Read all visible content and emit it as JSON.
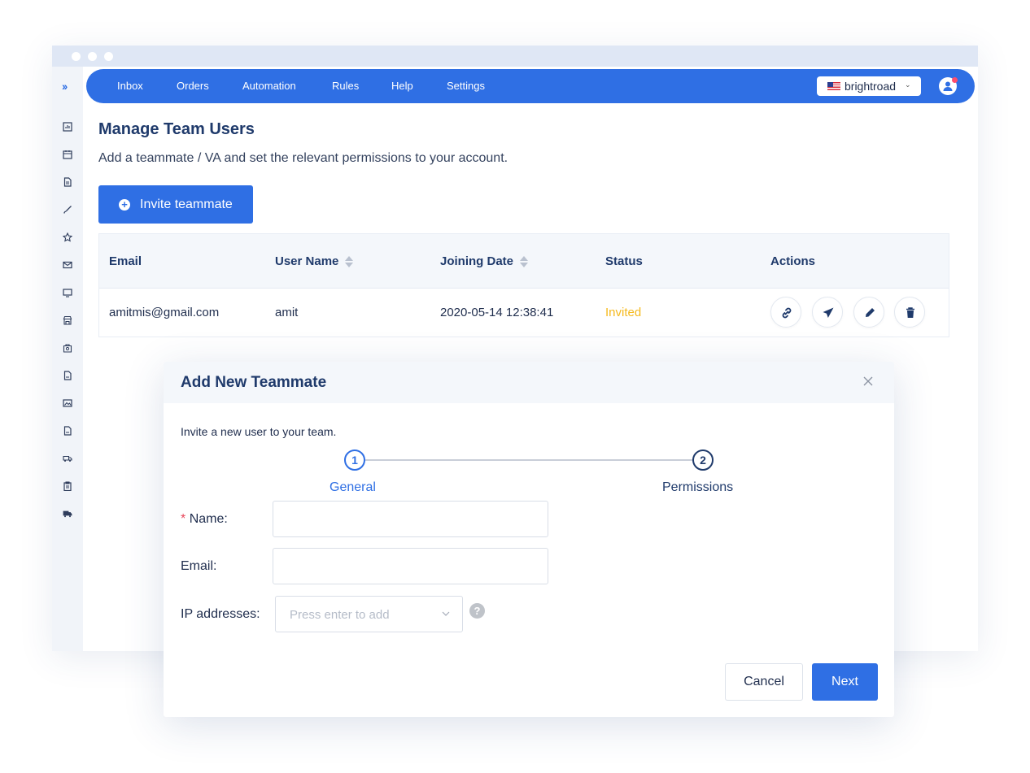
{
  "nav": {
    "items": [
      "Inbox",
      "Orders",
      "Automation",
      "Rules",
      "Help",
      "Settings"
    ],
    "account_name": "brightroad",
    "accent_color": "#2f6fe4"
  },
  "sidebar": {
    "toggle_icon": "double-chevron-right-icon",
    "icons": [
      "dashboard-icon",
      "calendar-icon",
      "document-icon",
      "brush-icon",
      "star-icon",
      "mail-icon",
      "monitor-icon",
      "store-icon",
      "bag-search-icon",
      "file-icon",
      "image-icon",
      "file-icon",
      "truck-icon",
      "clipboard-icon",
      "delivery-icon"
    ]
  },
  "page": {
    "title": "Manage Team Users",
    "subtitle": "Add a teammate / VA and set the relevant permissions to your account.",
    "invite_button": "Invite teammate"
  },
  "table": {
    "headers": [
      "Email",
      "User Name",
      "Joining Date",
      "Status",
      "Actions"
    ],
    "rows": [
      {
        "email": "amitmis@gmail.com",
        "user_name": "amit",
        "joining_date": "2020-05-14 12:38:41",
        "status": "Invited",
        "status_color": "#f5b91d",
        "actions": [
          "link-icon",
          "send-icon",
          "edit-icon",
          "trash-icon"
        ]
      }
    ]
  },
  "modal": {
    "title": "Add New Teammate",
    "description": "Invite a new user to your team.",
    "steps": [
      {
        "number": "1",
        "label": "General",
        "active": true
      },
      {
        "number": "2",
        "label": "Permissions",
        "active": false
      }
    ],
    "fields": {
      "name_required_mark": "*",
      "name_label": "Name:",
      "name_value": "",
      "email_label": "Email:",
      "email_value": "",
      "ip_label": "IP addresses:",
      "ip_placeholder": "Press enter to add",
      "help_icon_text": "?"
    },
    "cancel_button": "Cancel",
    "next_button": "Next"
  }
}
